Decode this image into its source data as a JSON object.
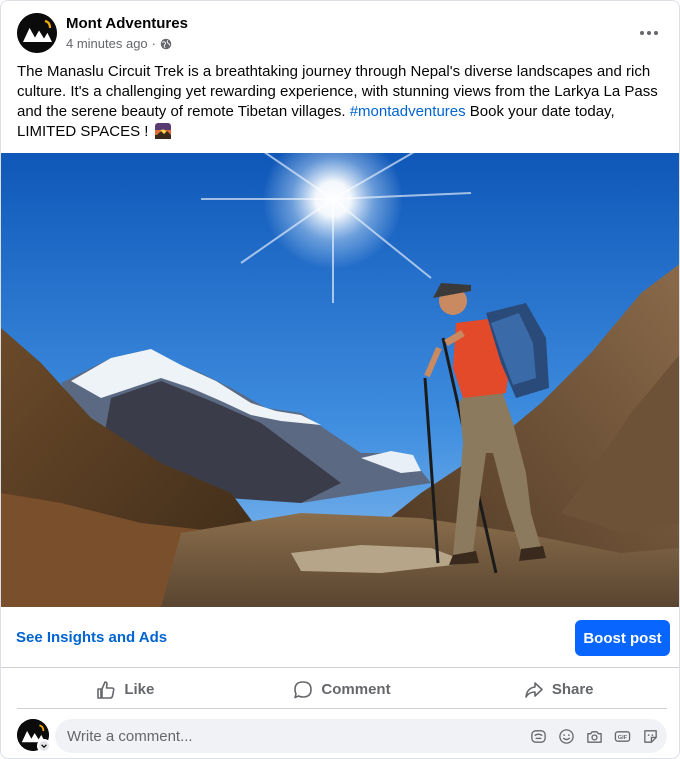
{
  "post": {
    "page_name": "Mont Adventures",
    "time": "4 minutes ago",
    "separator": "·",
    "privacy_icon": "globe-icon",
    "more_icon": "more-horizontal-icon",
    "text_main": "The Manaslu Circuit Trek is a breathtaking journey through Nepal's diverse landscapes and rich culture. It's a challenging yet rewarding experience, with stunning views from the Larkya La Pass and the serene beauty of remote Tibetan villages.",
    "hashtag": "#montadventures",
    "text_end": "Book your date today, LIMITED SPACES !",
    "emoji_icon": "sunrise-emoji-icon",
    "photo_alt": "Hiker with trekking poles looking at snowy Himalayan peaks under a bright sun"
  },
  "insights": {
    "link_label": "See Insights and Ads",
    "boost_label": "Boost post"
  },
  "actions": [
    {
      "label": "Like",
      "icon": "thumbs-up-icon"
    },
    {
      "label": "Comment",
      "icon": "speech-bubble-icon"
    },
    {
      "label": "Share",
      "icon": "share-arrow-icon"
    }
  ],
  "comment": {
    "placeholder": "Write a comment...",
    "tools": [
      "avatar-sticker-icon",
      "emoji-icon",
      "camera-icon",
      "gif-icon",
      "sticker-icon"
    ]
  },
  "colors": {
    "link": "#0064d1",
    "boost": "#0866ff",
    "secondary_text": "#65676b"
  }
}
